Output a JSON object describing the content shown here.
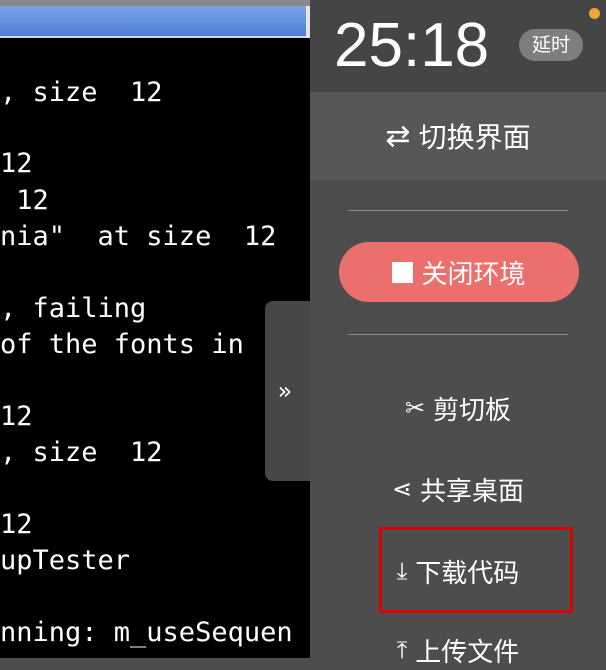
{
  "terminal": {
    "lines": [
      ", size  12",
      "12",
      " 12",
      "nia\"  at size  12",
      ", failing",
      "of the fonts in",
      "12",
      ", size  12",
      "12",
      "upTester",
      "nning: m_useSequen"
    ]
  },
  "sidebar_handle": {
    "icon": "double-chevron-right-icon",
    "glyph": "»"
  },
  "panel": {
    "timer": "25:18",
    "delay_label": "延时",
    "status_dot_color": "#f0a43a",
    "switch": {
      "icon": "swap-arrows-icon",
      "glyph": "⇄",
      "label": "切换界面"
    },
    "close": {
      "label": "关闭环境",
      "color": "#eb706d"
    },
    "menu": [
      {
        "icon": "scissors-icon",
        "glyph": "✂",
        "label": "剪切板"
      },
      {
        "icon": "share-icon",
        "glyph": "⋖",
        "label": "共享桌面"
      },
      {
        "icon": "download-icon",
        "glyph": "⤓",
        "label": "下载代码"
      },
      {
        "icon": "upload-icon",
        "glyph": "⤒",
        "label": "上传文件"
      }
    ],
    "highlight_color": "#d90000"
  }
}
